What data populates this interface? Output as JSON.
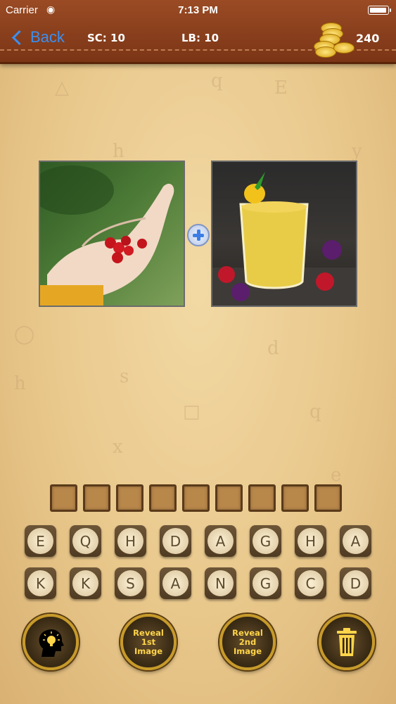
{
  "status_bar": {
    "carrier": "Carrier",
    "time": "7:13 PM"
  },
  "header": {
    "back_label": "Back",
    "score": "SC: 10",
    "level": "LB: 10",
    "coins": "240"
  },
  "puzzle": {
    "image_1": "hand holding red berries",
    "image_2": "glass of mango smoothie with pineapple",
    "answer_length": 9
  },
  "letters_row_1": [
    "E",
    "Q",
    "H",
    "D",
    "A",
    "G",
    "H",
    "A"
  ],
  "letters_row_2": [
    "K",
    "K",
    "S",
    "A",
    "N",
    "G",
    "C",
    "D"
  ],
  "actions": {
    "hint": "hint-bulb-head-icon",
    "reveal_first": "Reveal 1st Image",
    "reveal_second": "Reveal 2nd Image",
    "delete": "trash-icon"
  },
  "colors": {
    "header_bg": "#8a3f1c",
    "back_link": "#3b8ff0",
    "button_text": "#ffd54a",
    "gold_rim": "#c79a2a"
  }
}
